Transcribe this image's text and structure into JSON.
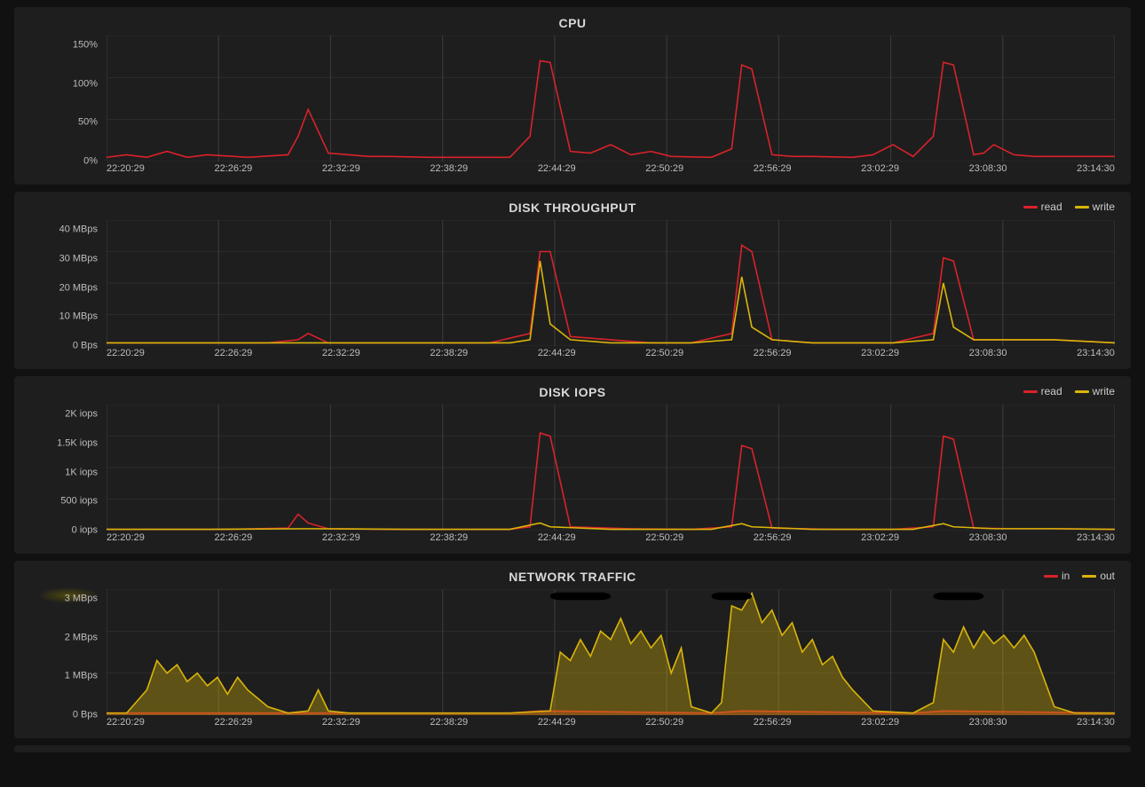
{
  "colors": {
    "red": "#d9222a",
    "yellow": "#d9b50a",
    "grid": "#3a3a3a"
  },
  "x_ticks": [
    "22:20:29",
    "22:26:29",
    "22:32:29",
    "22:38:29",
    "22:44:29",
    "22:50:29",
    "22:56:29",
    "23:02:29",
    "23:08:30",
    "23:14:30"
  ],
  "panels": {
    "cpu": {
      "title": "CPU",
      "legend": [],
      "y_ticks": [
        "150%",
        "100%",
        "50%",
        "0%"
      ]
    },
    "disk": {
      "title": "DISK THROUGHPUT",
      "legend": [
        {
          "color": "red",
          "label": "read"
        },
        {
          "color": "yellow",
          "label": "write"
        }
      ],
      "y_ticks": [
        "40 MBps",
        "30 MBps",
        "20 MBps",
        "10 MBps",
        "0 Bps"
      ]
    },
    "iops": {
      "title": "DISK IOPS",
      "legend": [
        {
          "color": "red",
          "label": "read"
        },
        {
          "color": "yellow",
          "label": "write"
        }
      ],
      "y_ticks": [
        "2K iops",
        "1.5K iops",
        "1K iops",
        "500 iops",
        "0 iops"
      ]
    },
    "net": {
      "title": "NETWORK TRAFFIC",
      "legend": [
        {
          "color": "red",
          "label": "in"
        },
        {
          "color": "yellow",
          "label": "out"
        }
      ],
      "y_ticks": [
        "3 MBps",
        "2 MBps",
        "1 MBps",
        "0 Bps"
      ]
    }
  },
  "chart_data": [
    {
      "id": "cpu",
      "type": "line",
      "title": "CPU",
      "xlabel": "",
      "ylabel": "",
      "ylim": [
        0,
        150
      ],
      "x_ticks_ref": "x_ticks",
      "series": [
        {
          "name": "cpu",
          "color": "red",
          "x": [
            0,
            2,
            4,
            6,
            8,
            10,
            14,
            18,
            19,
            20,
            22,
            24,
            26,
            28,
            32,
            36,
            40,
            42,
            43,
            44,
            46,
            48,
            50,
            52,
            54,
            56,
            60,
            62,
            63,
            64,
            66,
            68,
            70,
            74,
            76,
            78,
            80,
            82,
            83,
            84,
            86,
            87,
            88,
            90,
            92,
            94,
            96,
            100
          ],
          "y": [
            5,
            8,
            5,
            12,
            5,
            8,
            5,
            8,
            30,
            62,
            10,
            8,
            6,
            6,
            5,
            5,
            5,
            30,
            120,
            118,
            12,
            10,
            20,
            8,
            12,
            6,
            5,
            15,
            115,
            110,
            8,
            6,
            6,
            5,
            8,
            20,
            6,
            30,
            118,
            115,
            8,
            10,
            20,
            8,
            6,
            6,
            6,
            6
          ]
        }
      ]
    },
    {
      "id": "disk",
      "type": "line",
      "title": "DISK THROUGHPUT",
      "xlabel": "",
      "ylabel": "",
      "ylim": [
        0,
        40
      ],
      "x_ticks_ref": "x_ticks",
      "series": [
        {
          "name": "read",
          "color": "red",
          "x": [
            0,
            4,
            8,
            12,
            16,
            19,
            20,
            22,
            26,
            30,
            34,
            38,
            42,
            43,
            44,
            46,
            50,
            54,
            58,
            62,
            63,
            64,
            66,
            70,
            74,
            78,
            82,
            83,
            84,
            86,
            90,
            94,
            100
          ],
          "y": [
            1,
            1,
            1,
            1,
            1,
            2,
            4,
            1,
            1,
            1,
            1,
            1,
            4,
            30,
            30,
            3,
            2,
            1,
            1,
            4,
            32,
            30,
            2,
            1,
            1,
            1,
            4,
            28,
            27,
            2,
            2,
            2,
            1
          ]
        },
        {
          "name": "write",
          "color": "yellow",
          "x": [
            0,
            4,
            8,
            12,
            16,
            20,
            24,
            28,
            32,
            36,
            40,
            42,
            43,
            44,
            46,
            50,
            54,
            58,
            62,
            63,
            64,
            66,
            70,
            74,
            78,
            82,
            83,
            84,
            86,
            90,
            94,
            100
          ],
          "y": [
            1,
            1,
            1,
            1,
            1,
            1,
            1,
            1,
            1,
            1,
            1,
            2,
            27,
            7,
            2,
            1,
            1,
            1,
            2,
            22,
            6,
            2,
            1,
            1,
            1,
            2,
            20,
            6,
            2,
            2,
            2,
            1
          ]
        }
      ]
    },
    {
      "id": "iops",
      "type": "line",
      "title": "DISK IOPS",
      "xlabel": "",
      "ylabel": "",
      "ylim": [
        0,
        2000
      ],
      "x_ticks_ref": "x_ticks",
      "series": [
        {
          "name": "read",
          "color": "red",
          "x": [
            0,
            6,
            12,
            18,
            19,
            20,
            22,
            28,
            34,
            40,
            42,
            43,
            44,
            46,
            52,
            58,
            62,
            63,
            64,
            66,
            72,
            78,
            82,
            83,
            84,
            86,
            90,
            94,
            100
          ],
          "y": [
            20,
            20,
            20,
            40,
            260,
            120,
            30,
            20,
            20,
            20,
            60,
            1550,
            1500,
            60,
            30,
            20,
            60,
            1350,
            1300,
            40,
            20,
            20,
            60,
            1500,
            1450,
            40,
            30,
            30,
            20
          ]
        },
        {
          "name": "write",
          "color": "yellow",
          "x": [
            0,
            10,
            20,
            30,
            40,
            43,
            44,
            50,
            60,
            63,
            64,
            70,
            80,
            83,
            84,
            88,
            94,
            100
          ],
          "y": [
            20,
            20,
            30,
            20,
            20,
            120,
            60,
            20,
            20,
            110,
            60,
            20,
            20,
            110,
            60,
            30,
            30,
            20
          ]
        }
      ]
    },
    {
      "id": "net",
      "type": "area",
      "title": "NETWORK TRAFFIC",
      "xlabel": "",
      "ylabel": "",
      "ylim": [
        0,
        3
      ],
      "x_ticks_ref": "x_ticks",
      "series": [
        {
          "name": "in",
          "color": "red",
          "x": [
            0,
            20,
            40,
            43,
            60,
            63,
            80,
            83,
            100
          ],
          "y": [
            0.05,
            0.05,
            0.05,
            0.1,
            0.05,
            0.1,
            0.05,
            0.1,
            0.05
          ]
        },
        {
          "name": "out",
          "color": "yellow",
          "x": [
            0,
            2,
            4,
            5,
            6,
            7,
            8,
            9,
            10,
            11,
            12,
            13,
            14,
            16,
            18,
            20,
            21,
            22,
            24,
            28,
            32,
            36,
            40,
            44,
            45,
            46,
            47,
            48,
            49,
            50,
            51,
            52,
            53,
            54,
            55,
            56,
            57,
            58,
            60,
            61,
            62,
            63,
            64,
            65,
            66,
            67,
            68,
            69,
            70,
            71,
            72,
            73,
            74,
            76,
            80,
            82,
            83,
            84,
            85,
            86,
            87,
            88,
            89,
            90,
            91,
            92,
            94,
            96,
            100
          ],
          "y": [
            0.05,
            0.05,
            0.6,
            1.3,
            1.0,
            1.2,
            0.8,
            1.0,
            0.7,
            0.9,
            0.5,
            0.9,
            0.6,
            0.2,
            0.05,
            0.1,
            0.6,
            0.1,
            0.05,
            0.05,
            0.05,
            0.05,
            0.05,
            0.1,
            1.5,
            1.3,
            1.8,
            1.4,
            2.0,
            1.8,
            2.3,
            1.7,
            2.0,
            1.6,
            1.9,
            1.0,
            1.6,
            0.2,
            0.05,
            0.3,
            2.6,
            2.5,
            2.9,
            2.2,
            2.5,
            1.9,
            2.2,
            1.5,
            1.8,
            1.2,
            1.4,
            0.9,
            0.6,
            0.1,
            0.05,
            0.3,
            1.8,
            1.5,
            2.1,
            1.6,
            2.0,
            1.7,
            1.9,
            1.6,
            1.9,
            1.5,
            0.2,
            0.05,
            0.05
          ]
        }
      ]
    }
  ]
}
